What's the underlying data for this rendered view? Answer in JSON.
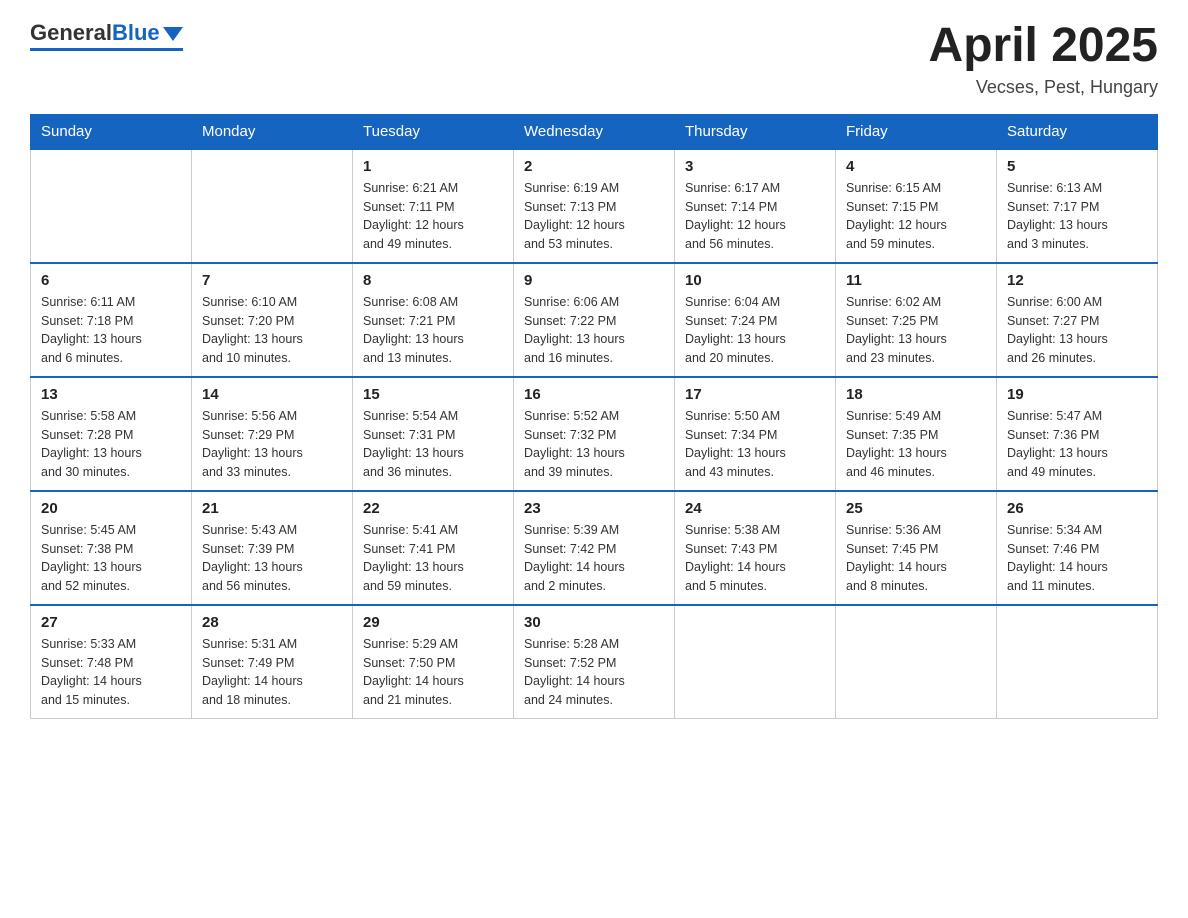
{
  "header": {
    "logo_general": "General",
    "logo_blue": "Blue",
    "title": "April 2025",
    "subtitle": "Vecses, Pest, Hungary"
  },
  "days_of_week": [
    "Sunday",
    "Monday",
    "Tuesday",
    "Wednesday",
    "Thursday",
    "Friday",
    "Saturday"
  ],
  "weeks": [
    [
      {
        "day": "",
        "info": ""
      },
      {
        "day": "",
        "info": ""
      },
      {
        "day": "1",
        "info": "Sunrise: 6:21 AM\nSunset: 7:11 PM\nDaylight: 12 hours\nand 49 minutes."
      },
      {
        "day": "2",
        "info": "Sunrise: 6:19 AM\nSunset: 7:13 PM\nDaylight: 12 hours\nand 53 minutes."
      },
      {
        "day": "3",
        "info": "Sunrise: 6:17 AM\nSunset: 7:14 PM\nDaylight: 12 hours\nand 56 minutes."
      },
      {
        "day": "4",
        "info": "Sunrise: 6:15 AM\nSunset: 7:15 PM\nDaylight: 12 hours\nand 59 minutes."
      },
      {
        "day": "5",
        "info": "Sunrise: 6:13 AM\nSunset: 7:17 PM\nDaylight: 13 hours\nand 3 minutes."
      }
    ],
    [
      {
        "day": "6",
        "info": "Sunrise: 6:11 AM\nSunset: 7:18 PM\nDaylight: 13 hours\nand 6 minutes."
      },
      {
        "day": "7",
        "info": "Sunrise: 6:10 AM\nSunset: 7:20 PM\nDaylight: 13 hours\nand 10 minutes."
      },
      {
        "day": "8",
        "info": "Sunrise: 6:08 AM\nSunset: 7:21 PM\nDaylight: 13 hours\nand 13 minutes."
      },
      {
        "day": "9",
        "info": "Sunrise: 6:06 AM\nSunset: 7:22 PM\nDaylight: 13 hours\nand 16 minutes."
      },
      {
        "day": "10",
        "info": "Sunrise: 6:04 AM\nSunset: 7:24 PM\nDaylight: 13 hours\nand 20 minutes."
      },
      {
        "day": "11",
        "info": "Sunrise: 6:02 AM\nSunset: 7:25 PM\nDaylight: 13 hours\nand 23 minutes."
      },
      {
        "day": "12",
        "info": "Sunrise: 6:00 AM\nSunset: 7:27 PM\nDaylight: 13 hours\nand 26 minutes."
      }
    ],
    [
      {
        "day": "13",
        "info": "Sunrise: 5:58 AM\nSunset: 7:28 PM\nDaylight: 13 hours\nand 30 minutes."
      },
      {
        "day": "14",
        "info": "Sunrise: 5:56 AM\nSunset: 7:29 PM\nDaylight: 13 hours\nand 33 minutes."
      },
      {
        "day": "15",
        "info": "Sunrise: 5:54 AM\nSunset: 7:31 PM\nDaylight: 13 hours\nand 36 minutes."
      },
      {
        "day": "16",
        "info": "Sunrise: 5:52 AM\nSunset: 7:32 PM\nDaylight: 13 hours\nand 39 minutes."
      },
      {
        "day": "17",
        "info": "Sunrise: 5:50 AM\nSunset: 7:34 PM\nDaylight: 13 hours\nand 43 minutes."
      },
      {
        "day": "18",
        "info": "Sunrise: 5:49 AM\nSunset: 7:35 PM\nDaylight: 13 hours\nand 46 minutes."
      },
      {
        "day": "19",
        "info": "Sunrise: 5:47 AM\nSunset: 7:36 PM\nDaylight: 13 hours\nand 49 minutes."
      }
    ],
    [
      {
        "day": "20",
        "info": "Sunrise: 5:45 AM\nSunset: 7:38 PM\nDaylight: 13 hours\nand 52 minutes."
      },
      {
        "day": "21",
        "info": "Sunrise: 5:43 AM\nSunset: 7:39 PM\nDaylight: 13 hours\nand 56 minutes."
      },
      {
        "day": "22",
        "info": "Sunrise: 5:41 AM\nSunset: 7:41 PM\nDaylight: 13 hours\nand 59 minutes."
      },
      {
        "day": "23",
        "info": "Sunrise: 5:39 AM\nSunset: 7:42 PM\nDaylight: 14 hours\nand 2 minutes."
      },
      {
        "day": "24",
        "info": "Sunrise: 5:38 AM\nSunset: 7:43 PM\nDaylight: 14 hours\nand 5 minutes."
      },
      {
        "day": "25",
        "info": "Sunrise: 5:36 AM\nSunset: 7:45 PM\nDaylight: 14 hours\nand 8 minutes."
      },
      {
        "day": "26",
        "info": "Sunrise: 5:34 AM\nSunset: 7:46 PM\nDaylight: 14 hours\nand 11 minutes."
      }
    ],
    [
      {
        "day": "27",
        "info": "Sunrise: 5:33 AM\nSunset: 7:48 PM\nDaylight: 14 hours\nand 15 minutes."
      },
      {
        "day": "28",
        "info": "Sunrise: 5:31 AM\nSunset: 7:49 PM\nDaylight: 14 hours\nand 18 minutes."
      },
      {
        "day": "29",
        "info": "Sunrise: 5:29 AM\nSunset: 7:50 PM\nDaylight: 14 hours\nand 21 minutes."
      },
      {
        "day": "30",
        "info": "Sunrise: 5:28 AM\nSunset: 7:52 PM\nDaylight: 14 hours\nand 24 minutes."
      },
      {
        "day": "",
        "info": ""
      },
      {
        "day": "",
        "info": ""
      },
      {
        "day": "",
        "info": ""
      }
    ]
  ]
}
